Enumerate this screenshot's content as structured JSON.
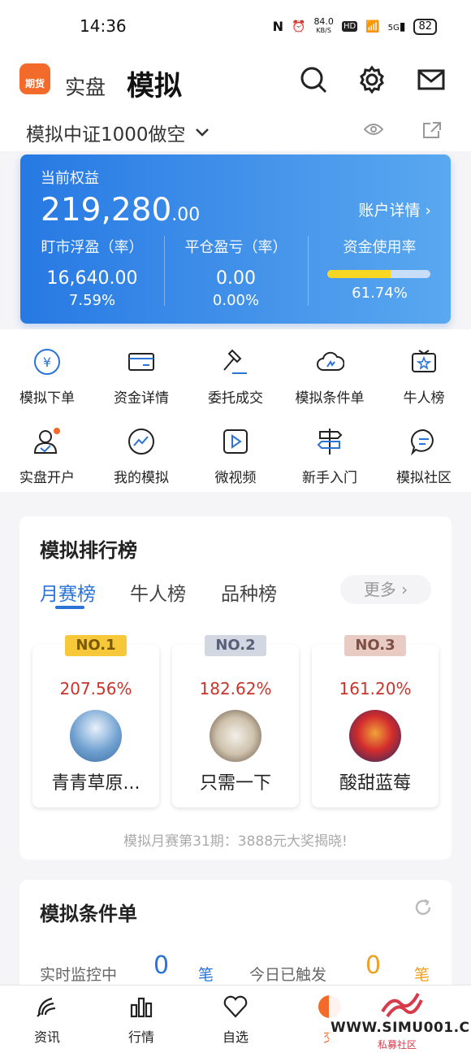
{
  "status": {
    "time": "14:36",
    "speed": "84.0",
    "speed_unit": "KB/S",
    "hd": "HD",
    "net": "5G",
    "battery": "82"
  },
  "header": {
    "logo_text": "期货",
    "tab_real": "实盘",
    "tab_sim": "模拟",
    "account_name": "模拟中证1000做空"
  },
  "card": {
    "equity_label": "当前权益",
    "equity_int": "219,280",
    "equity_dec": ".00",
    "detail_link": "账户详情",
    "float_label": "盯市浮盈（率）",
    "float_value": "16,640.00",
    "float_rate": "7.59%",
    "close_label": "平仓盈亏（率）",
    "close_value": "0.00",
    "close_rate": "0.00%",
    "usage_label": "资金使用率",
    "usage_rate": "61.74%",
    "usage_fraction": 0.6174
  },
  "grid": [
    {
      "label": "模拟下单",
      "icon": "yen-coin-icon"
    },
    {
      "label": "资金详情",
      "icon": "card-icon"
    },
    {
      "label": "委托成交",
      "icon": "gavel-icon"
    },
    {
      "label": "模拟条件单",
      "icon": "cloud-icon"
    },
    {
      "label": "牛人榜",
      "icon": "star-screen-icon"
    },
    {
      "label": "实盘开户",
      "icon": "user-icon"
    },
    {
      "label": "我的模拟",
      "icon": "chart-line-icon"
    },
    {
      "label": "微视频",
      "icon": "play-icon"
    },
    {
      "label": "新手入门",
      "icon": "signpost-icon"
    },
    {
      "label": "模拟社区",
      "icon": "chat-icon"
    }
  ],
  "rank": {
    "title": "模拟排行榜",
    "tabs": [
      "月赛榜",
      "牛人榜",
      "品种榜"
    ],
    "more": "更多",
    "cards": [
      {
        "badge": "NO.1",
        "pct": "207.56%",
        "name": "青青草原...",
        "badge_color": "#f7c93a",
        "badge_text_color": "#7a5a00"
      },
      {
        "badge": "NO.2",
        "pct": "182.62%",
        "name": "只需一下",
        "badge_color": "#d3d7e2",
        "badge_text_color": "#59607a"
      },
      {
        "badge": "NO.3",
        "pct": "161.20%",
        "name": "酸甜蓝莓",
        "badge_color": "#e8cbc2",
        "badge_text_color": "#7d4f45"
      }
    ],
    "note": "模拟月赛第31期：3888元大奖揭晓!"
  },
  "cond": {
    "title": "模拟条件单",
    "monitor_label": "实时监控中",
    "monitor_count": "0",
    "unit": "笔",
    "triggered_label": "今日已触发",
    "triggered_count": "0"
  },
  "nav": [
    {
      "label": "资讯",
      "icon": "news-icon"
    },
    {
      "label": "行情",
      "icon": "bars-icon"
    },
    {
      "label": "自选",
      "icon": "heart-icon"
    },
    {
      "label": "交",
      "icon": "trade-icon"
    }
  ],
  "watermark": {
    "url": "WWW.SIMU001.CN",
    "sub": "私募社区"
  },
  "colors": {
    "accent": "#2b73d6",
    "card_start": "#2779e3",
    "card_end": "#5aa8f0",
    "usage_fill": "#f7d722",
    "red": "#c8342c",
    "orange": "#f0a020"
  }
}
